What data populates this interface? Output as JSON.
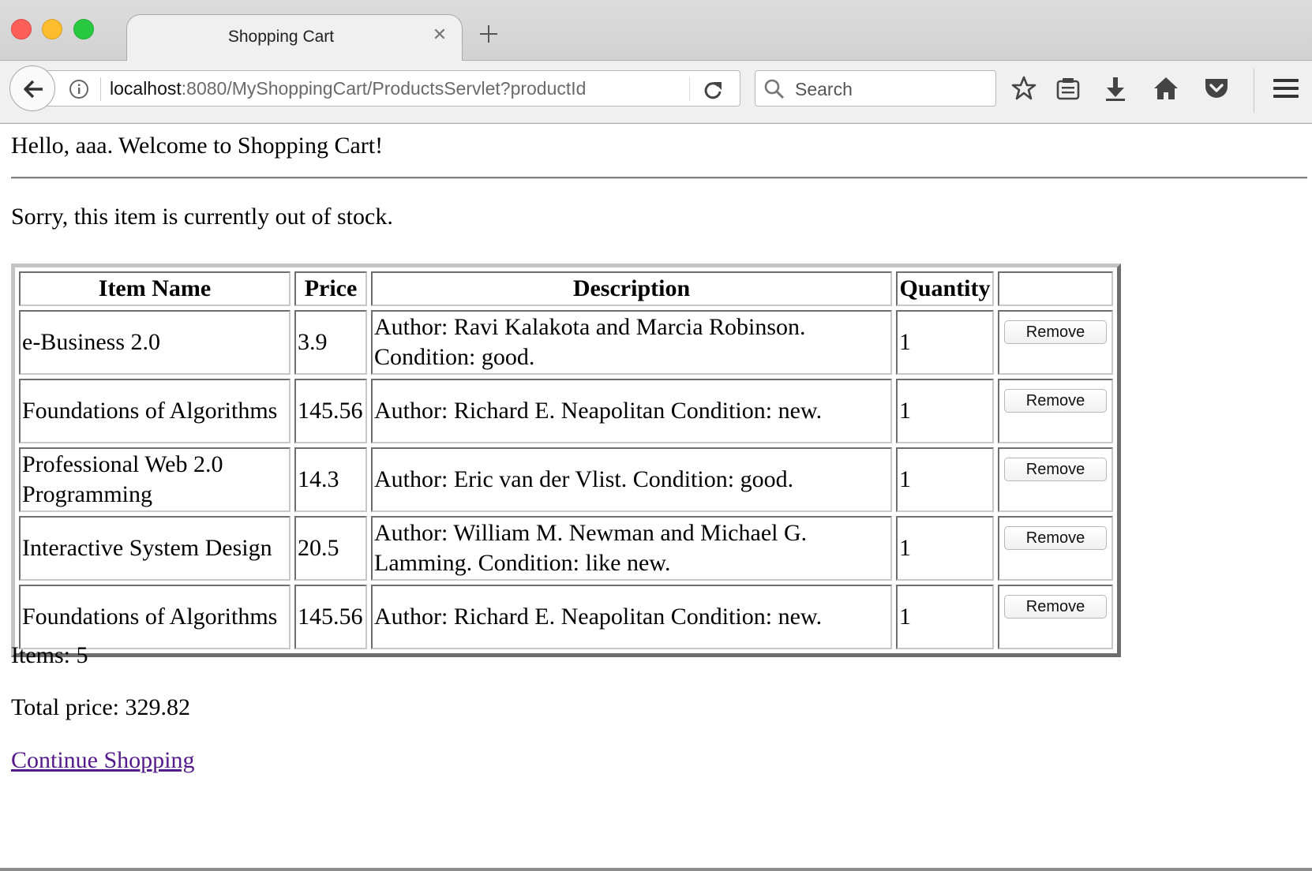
{
  "browser": {
    "tab_title": "Shopping Cart",
    "url_host": "localhost",
    "url_rest": ":8080/MyShoppingCart/ProductsServlet?productId",
    "search_placeholder": "Search"
  },
  "page": {
    "greeting": "Hello, aaa. Welcome to Shopping Cart!",
    "message": "Sorry, this item is currently out of stock.",
    "table": {
      "headers": [
        "Item Name",
        "Price",
        "Description",
        "Quantity",
        ""
      ],
      "rows": [
        {
          "name": "e-Business 2.0",
          "price": "3.9",
          "description": "Author: Ravi Kalakota and Marcia Robinson. Condition: good.",
          "quantity": "1",
          "action": "Remove"
        },
        {
          "name": "Foundations of Algorithms",
          "price": "145.56",
          "description": "Author: Richard E. Neapolitan Condition: new.",
          "quantity": "1",
          "action": "Remove"
        },
        {
          "name": "Professional Web 2.0 Programming",
          "price": "14.3",
          "description": "Author: Eric van der Vlist. Condition: good.",
          "quantity": "1",
          "action": "Remove"
        },
        {
          "name": "Interactive System Design",
          "price": "20.5",
          "description": "Author: William M. Newman and Michael G. Lamming. Condition: like new.",
          "quantity": "1",
          "action": "Remove"
        },
        {
          "name": "Foundations of Algorithms",
          "price": "145.56",
          "description": "Author: Richard E. Neapolitan Condition: new.",
          "quantity": "1",
          "action": "Remove"
        }
      ]
    },
    "items_count": "Items: 5",
    "total_price": "Total price: 329.82",
    "continue_link": "Continue Shopping"
  },
  "colors": {
    "link_visited": "#551a8b",
    "close_light": "#fc5f57",
    "minimize_light": "#fdbc2e",
    "zoom_light": "#28c940"
  },
  "icons": [
    "info-icon",
    "reload-icon",
    "search-icon",
    "bookmark-star-icon",
    "reading-list-icon",
    "download-icon",
    "home-icon",
    "pocket-icon",
    "menu-icon",
    "back-arrow-icon",
    "close-tab-icon",
    "new-tab-icon"
  ]
}
